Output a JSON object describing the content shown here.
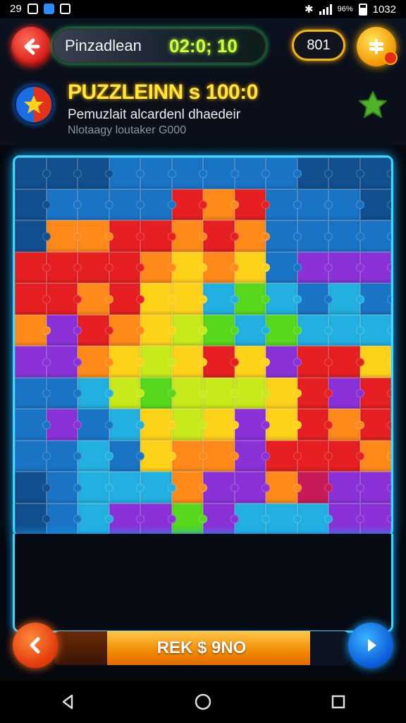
{
  "status_bar": {
    "time_left": "29",
    "time_right": "1032",
    "battery": "96%"
  },
  "topbar": {
    "title": "Pinzadlean",
    "timer": "02:0; 10",
    "score": "801"
  },
  "header": {
    "title": "PUZZLEINN s 100:0",
    "subtitle": "Pemuzlait alcardenl dhaedeir",
    "tagline": "Nlotaagy loutaker G000"
  },
  "board": {
    "rows": 12,
    "cols": 12,
    "palette": {
      "B": "#1a74c6",
      "D": "#114f8f",
      "O": "#ff8a1a",
      "R": "#e51f22",
      "Y": "#ffd21a",
      "L": "#c8ea1a",
      "G": "#58d81c",
      "P": "#8a32d8",
      "T": "#22b0e0",
      "M": "#c81a58"
    },
    "layout": [
      "DDDBBBBBBDDD",
      "DBBBBRORBBBD",
      "DOORROROBBBB",
      "RRRROYOYBPPP",
      "RRORYYTGTBTB",
      "OPROYLGTGTTT",
      "PPOYLYRYPRRY",
      "BBTLGLLLYRPR",
      "BPBTYLYPYROR",
      "BBTBYOOPRRRO",
      "DBTTTOPPOMPP",
      "DBTPPGPTTTPP"
    ]
  },
  "progress": {
    "label": "REK $ 9NO",
    "value": 0.87
  },
  "colors": {
    "accent": "#3ad8ff",
    "timer": "#d4ff3a",
    "title": "#ffe63a"
  },
  "icons": [
    "back-arrow-icon",
    "coin-icon",
    "star-badge-icon",
    "star-icon",
    "prev-arrow-icon",
    "next-arrow-icon",
    "nav-back-icon",
    "nav-home-icon",
    "nav-recents-icon"
  ]
}
